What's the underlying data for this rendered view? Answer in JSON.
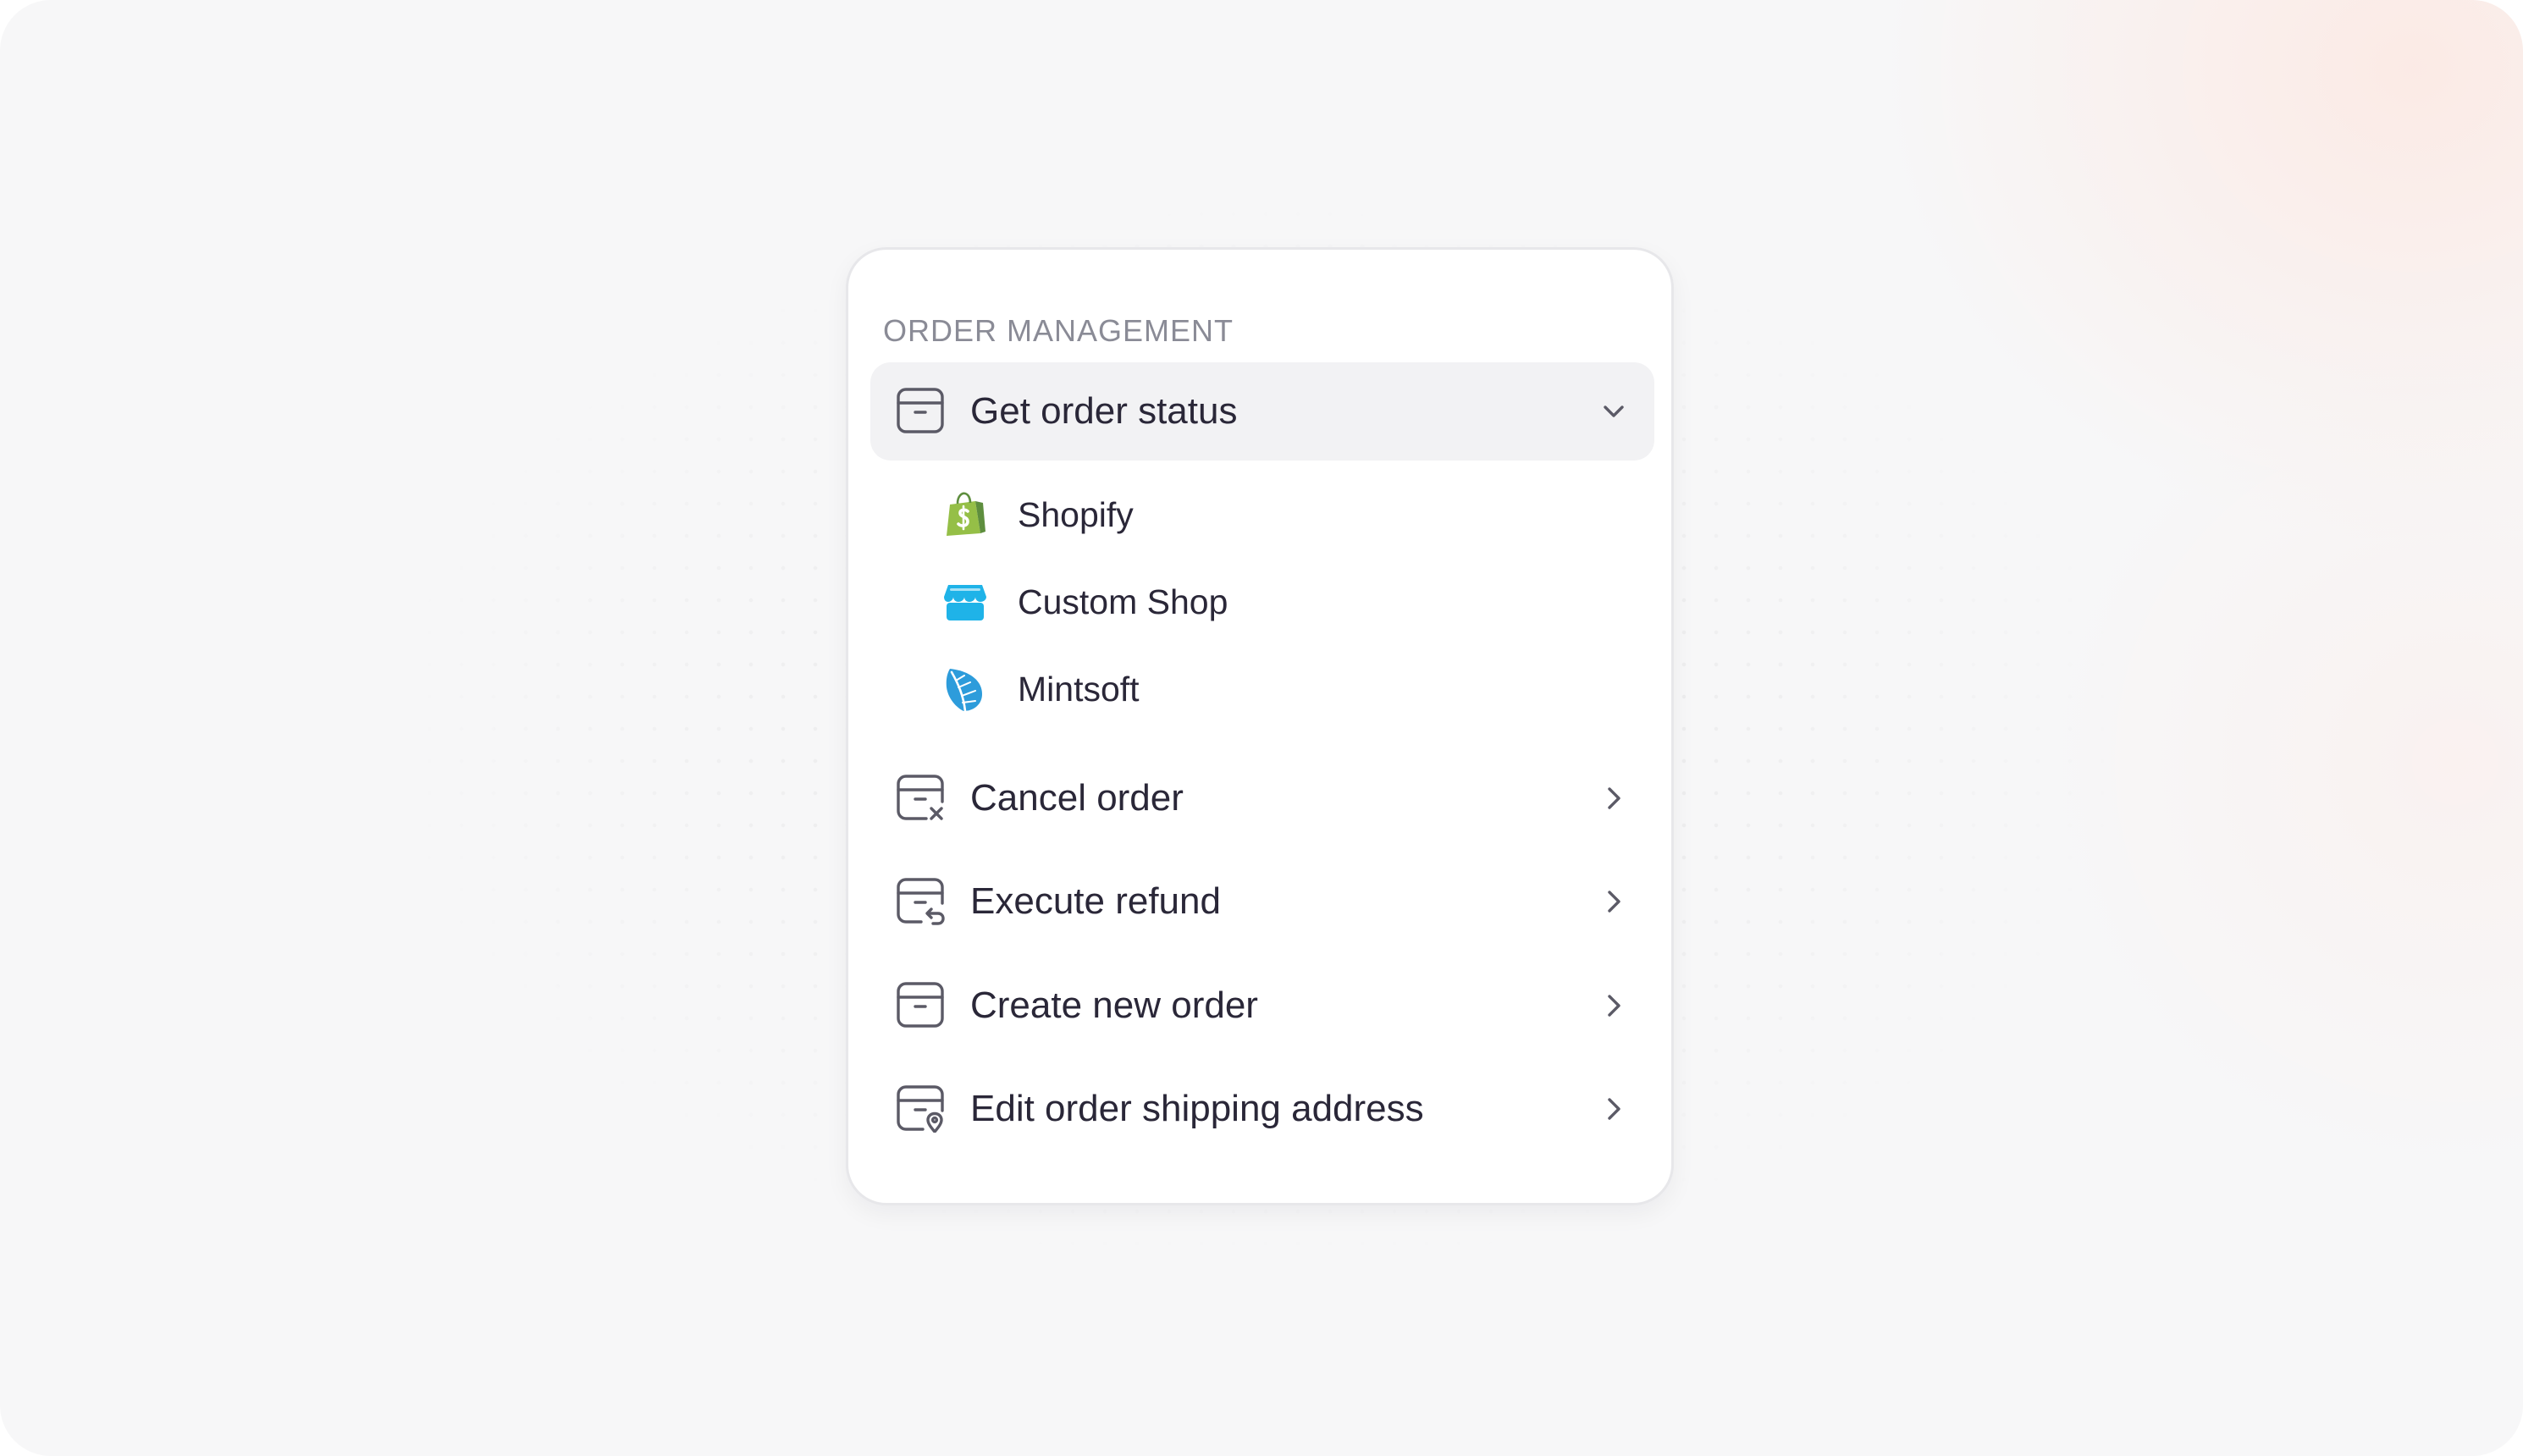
{
  "panel": {
    "section_title": "ORDER MANAGEMENT",
    "active_item": {
      "label": "Get order status",
      "icon": "package-icon",
      "expanded": true,
      "sub_items": [
        {
          "label": "Shopify",
          "icon": "shopify-logo",
          "color": "#95BF47"
        },
        {
          "label": "Custom Shop",
          "icon": "store-icon",
          "color": "#1FB3E8"
        },
        {
          "label": "Mintsoft",
          "icon": "mintsoft-leaf-logo",
          "color": "#2D9CDB"
        }
      ]
    },
    "items": [
      {
        "label": "Cancel order",
        "icon": "package-cancel-icon"
      },
      {
        "label": "Execute refund",
        "icon": "package-refund-icon"
      },
      {
        "label": "Create new order",
        "icon": "package-icon"
      },
      {
        "label": "Edit order shipping address",
        "icon": "package-location-icon"
      }
    ]
  },
  "colors": {
    "text_primary": "#2a2738",
    "text_muted": "#8a8b96",
    "icon_stroke": "#5b5a66",
    "active_bg": "#f2f2f4"
  }
}
